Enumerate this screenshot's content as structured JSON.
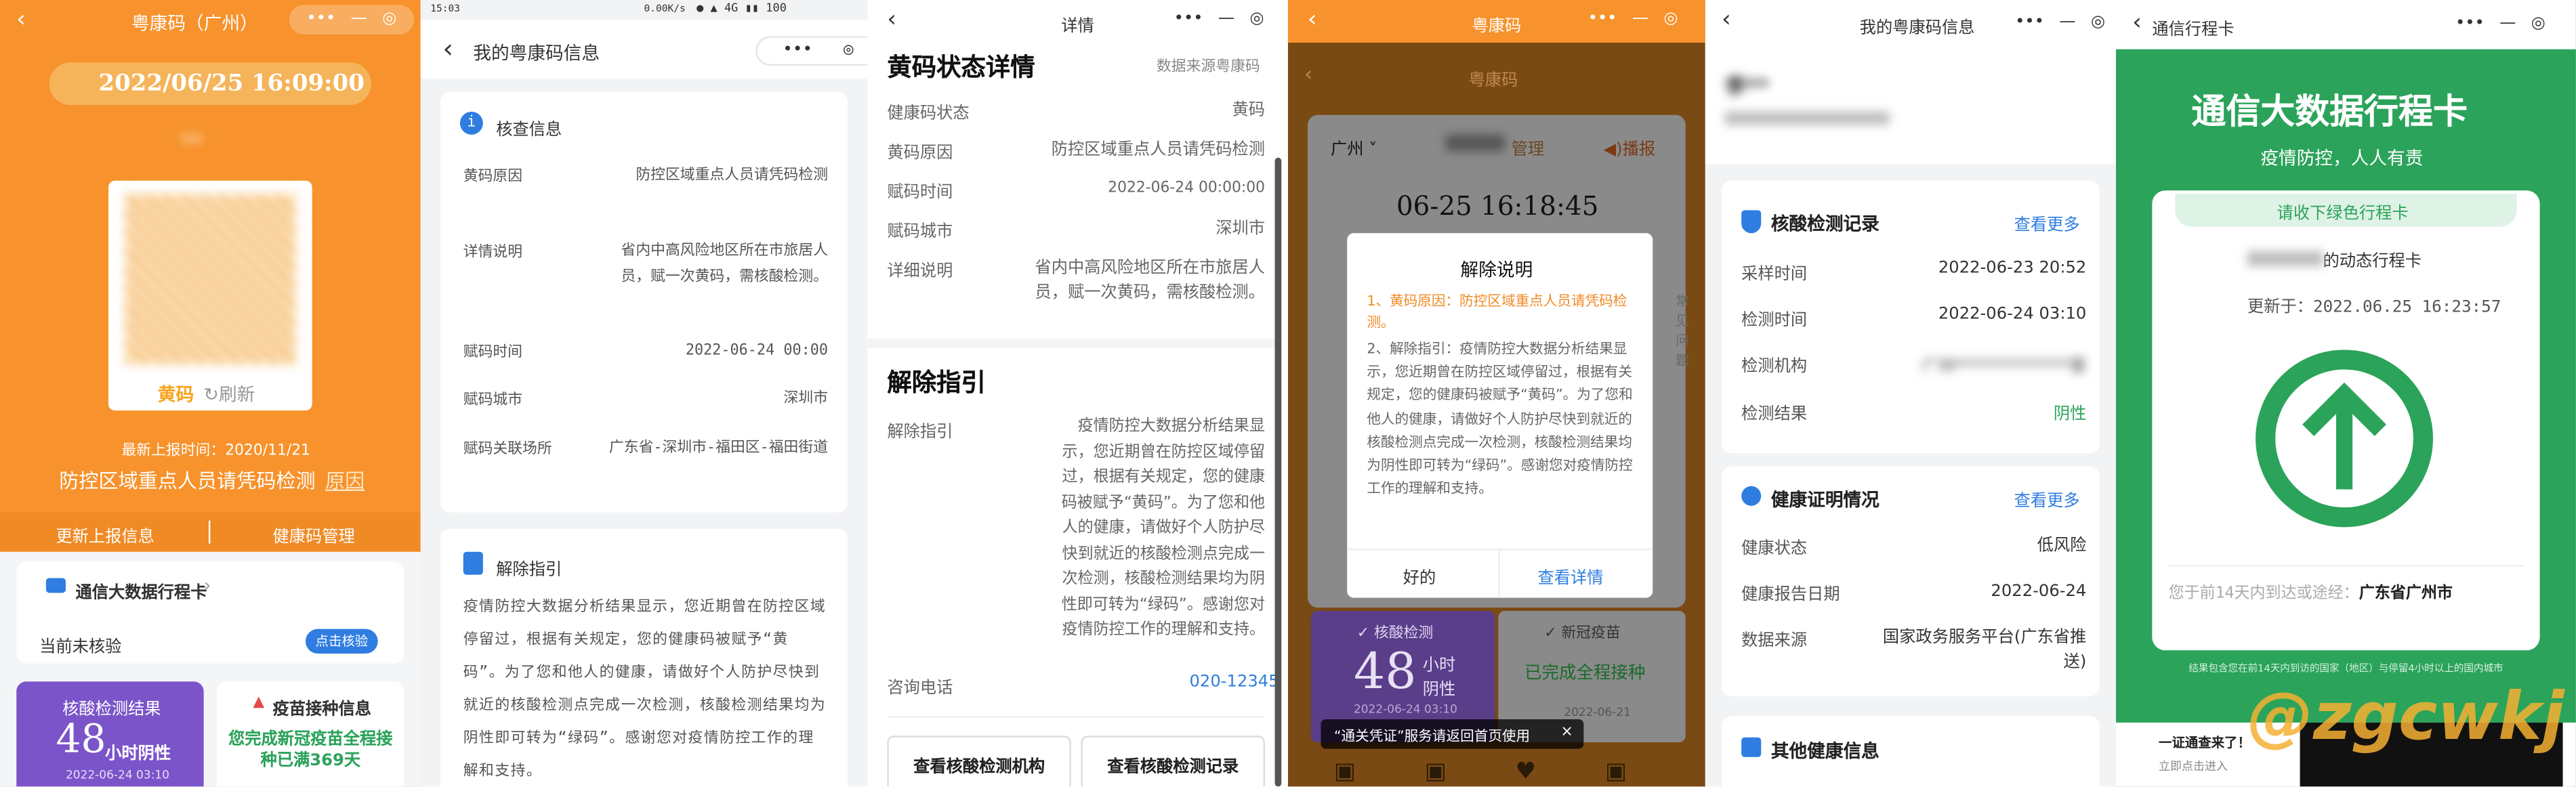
{
  "p1": {
    "title": "粤康码（广州）",
    "datetime": "2022/06/25 16:09:00",
    "name_masked": "**",
    "code_color": "黄码",
    "refresh": "刷新",
    "last_report_prefix": "最新上报时间：",
    "last_report_date": "2020/11/21",
    "reason": "防控区域重点人员请凭码检测",
    "reason_link": "原因",
    "update_info": "更新上报信息",
    "health_code_manage": "健康码管理",
    "travel_card_title": "通信大数据行程卡",
    "travel_card_status": "当前未核验",
    "verify_btn": "点击核验",
    "nucleic_title": "核酸检测结果",
    "nucleic_hours": "48",
    "nucleic_unit": "小时阴性",
    "nucleic_time": "2022-06-24 03:10",
    "vaccine_title": "疫苗接种信息",
    "vaccine_text": "您完成新冠疫苗全程接种已满369天"
  },
  "p2": {
    "status_time": "15:03",
    "status_right": "0.00K/s",
    "title": "我的粤康码信息",
    "check_title": "核查信息",
    "rows": [
      {
        "label": "黄码原因",
        "value": "防控区域重点人员请凭码检测"
      },
      {
        "label": "详情说明",
        "value": "省内中高风险地区所在市旅居人员，赋一次黄码，需核酸检测。"
      },
      {
        "label": "赋码时间",
        "value": "2022-06-24 00:00"
      },
      {
        "label": "赋码城市",
        "value": "深圳市"
      },
      {
        "label": "赋码关联场所",
        "value": "广东省-深圳市-福田区-福田街道"
      }
    ],
    "release_title": "解除指引",
    "release_text": "疫情防控大数据分析结果显示，您近期曾在防控区域停留过，根据有关规定，您的健康码被赋予“黄码”。为了您和他人的健康，请做好个人防护尽快到就近的核酸检测点完成一次检测，核酸检测结果均为阴性即可转为“绿码”。感谢您对疫情防控工作的理解和支持。"
  },
  "p3": {
    "title": "详情",
    "status_title": "黄码状态详情",
    "source": "数据来源粤康码",
    "rows": [
      {
        "label": "健康码状态",
        "value": "黄码"
      },
      {
        "label": "黄码原因",
        "value": "防控区域重点人员请凭码检测"
      },
      {
        "label": "赋码时间",
        "value": "2022-06-24 00:00:00"
      },
      {
        "label": "赋码城市",
        "value": "深圳市"
      },
      {
        "label": "详细说明",
        "value": "省内中高风险地区所在市旅居人员，赋一次黄码，需核酸检测。"
      }
    ],
    "release_title": "解除指引",
    "release_label": "解除指引",
    "release_text": "疫情防控大数据分析结果显示，您近期曾在防控区域停留过，根据有关规定，您的健康码被赋予“黄码”。为了您和他人的健康，请做好个人防护尽快到就近的核酸检测点完成一次检测，核酸检测结果均为阴性即可转为“绿码”。感谢您对疫情防控工作的理解和支持。",
    "phone_label": "咨询电话",
    "phone": "020-12345",
    "btn_org": "查看核酸检测机构",
    "btn_record": "查看核酸检测记录"
  },
  "p4": {
    "title": "粤康码",
    "inner_title": "粤康码",
    "city": "广州",
    "manage": "管理",
    "broadcast": "播报",
    "datetime": "06-25 16:18:45",
    "dialog_title": "解除说明",
    "dialog_reason": "1、黄码原因：防控区域重点人员请凭码检测。",
    "dialog_text": "2、解除指引：疫情防控大数据分析结果显示，您近期曾在防控区域停留过，根据有关规定，您的健康码被赋予“黄码”。为了您和他人的健康，请做好个人防护尽快到就近的核酸检测点完成一次检测，核酸检测结果均为阴性即可转为“绿码”。感谢您对疫情防控工作的理解和支持。",
    "dialog_ok": "好的",
    "dialog_detail": "查看详情",
    "side_text": "常见问题",
    "nucleic_title": "核酸检测",
    "nucleic_hours": "48",
    "nucleic_unit1": "小时",
    "nucleic_unit2": "阴性",
    "nucleic_time": "2022-06-24 03:10",
    "vaccine_title": "新冠疫苗",
    "vaccine_text": "已完成全程接种",
    "vaccine_date": "2022-06-21",
    "toast": "“通关凭证”服务请返回首页使用"
  },
  "p5": {
    "title": "我的粤康码信息",
    "name_masked": "李**",
    "nucleic_title": "核酸检测记录",
    "view_more": "查看更多",
    "nucleic_rows": [
      {
        "label": "采样时间",
        "value": "2022-06-23 20:52"
      },
      {
        "label": "检测时间",
        "value": "2022-06-24 03:10"
      },
      {
        "label": "检测机构",
        "value": "广州**************室"
      },
      {
        "label": "检测结果",
        "value": "阴性"
      }
    ],
    "health_title": "健康证明情况",
    "health_rows": [
      {
        "label": "健康状态",
        "value": "低风险"
      },
      {
        "label": "健康报告日期",
        "value": "2022-06-24"
      },
      {
        "label": "数据来源",
        "value": "国家政务服务平台(广东省推送)"
      }
    ],
    "other_title": "其他健康信息"
  },
  "p6": {
    "title": "通信行程卡",
    "big_title": "通信大数据行程卡",
    "subtitle": "疫情防控，人人有责",
    "tab": "请收下绿色行程卡",
    "phone_suffix": "的动态行程卡",
    "update_prefix": "更新于：",
    "update_time": "2022.06.25 16:23:57",
    "visited_label": "您于前14天内到达或途经：",
    "visited_value": "广东省广州市",
    "footer_note": "结果包含您在前14天内到访的国家（地区）与停留4小时以上的国内城市",
    "bottom_left": "一证通查来了！",
    "bottom_left2": "立即点击进入",
    "watermark": "@zgcwkj"
  },
  "colors": {
    "orange": "#f7922c",
    "orange_dark": "#f08a24",
    "yellow_code": "#f5a623",
    "green": "#2ba35a",
    "blue": "#2f7de1",
    "purple": "#7b54c9"
  }
}
